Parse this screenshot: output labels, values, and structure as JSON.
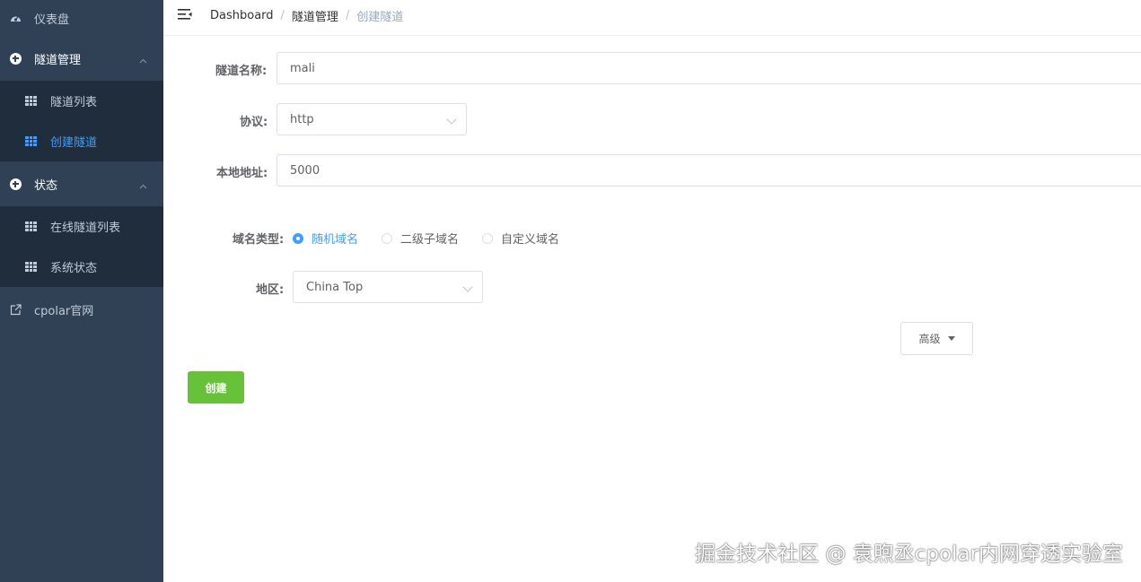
{
  "sidebar": {
    "dashboard": {
      "label": "仪表盘",
      "icon": "dashboard-icon"
    },
    "tunnel_mgmt": {
      "label": "隧道管理",
      "icon": "circle-plus-icon"
    },
    "tunnel_list": {
      "label": "隧道列表",
      "icon": "table-icon"
    },
    "create_tunnel": {
      "label": "创建隧道",
      "icon": "table-icon"
    },
    "status": {
      "label": "状态",
      "icon": "circle-plus-icon"
    },
    "online_tunnels": {
      "label": "在线隧道列表",
      "icon": "table-icon"
    },
    "system_status": {
      "label": "系统状态",
      "icon": "table-icon"
    },
    "cpolar_site": {
      "label": "cpolar官网",
      "icon": "external-link-icon"
    }
  },
  "header": {
    "breadcrumb": [
      "Dashboard",
      "隧道管理",
      "创建隧道"
    ],
    "separator": "/"
  },
  "form": {
    "name_label": "隧道名称:",
    "name_value": "mali",
    "protocol_label": "协议:",
    "protocol_value": "http",
    "local_addr_label": "本地地址:",
    "local_addr_value": "5000",
    "domain_type_label": "域名类型:",
    "domain_types": [
      "随机域名",
      "二级子域名",
      "自定义域名"
    ],
    "domain_type_selected": "随机域名",
    "region_label": "地区:",
    "region_value": "China Top",
    "advanced_label": "高级",
    "create_label": "创建"
  },
  "watermark": "掘金技术社区 @ 袁煦丞cpolar内网穿透实验室",
  "colors": {
    "sidebar_bg": "#304156",
    "submenu_bg": "#1f2d3d",
    "accent": "#409eff",
    "create_btn": "#67c23a"
  }
}
